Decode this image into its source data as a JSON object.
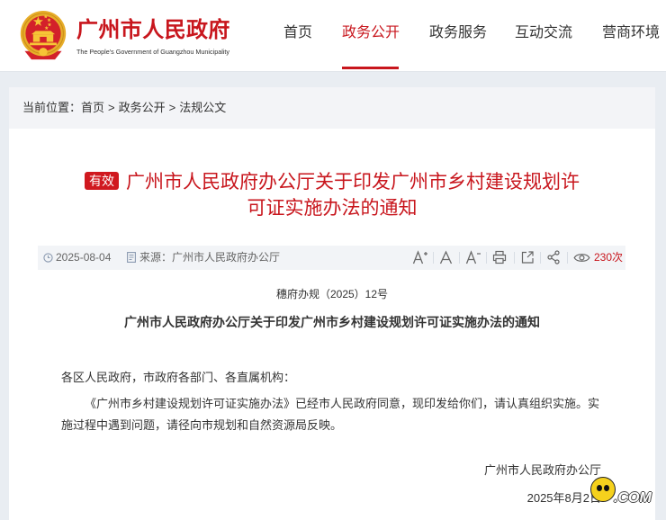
{
  "header": {
    "site_title": "广州市人民政府",
    "site_subtitle": "The People's Government of Guangzhou Municipality",
    "logo_icon": "national-emblem-icon",
    "nav": [
      {
        "label": "首页",
        "active": false
      },
      {
        "label": "政务公开",
        "active": true
      },
      {
        "label": "政务服务",
        "active": false
      },
      {
        "label": "互动交流",
        "active": false
      },
      {
        "label": "营商环境",
        "active": false
      }
    ]
  },
  "breadcrumb": {
    "prefix": "当前位置：",
    "separator": ">",
    "items": [
      "首页",
      "政务公开",
      "法规公文"
    ]
  },
  "article": {
    "status_badge": "有效",
    "title": "广州市人民政府办公厅关于印发广州市乡村建设规划许可证实施办法的通知",
    "meta": {
      "date_icon": "clock-icon",
      "date": "2025-08-04",
      "source_icon": "document-icon",
      "source_label": "来源：",
      "source": "广州市人民政府办公厅",
      "views": "230次"
    },
    "tools": [
      "font-increase-icon",
      "font-reset-icon",
      "font-decrease-icon",
      "print-icon",
      "export-icon",
      "share-icon",
      "views-eye-icon"
    ],
    "doc_number": "穗府办规（2025）12号",
    "heading": "广州市人民政府办公厅关于印发广州市乡村建设规划许可证实施办法的通知",
    "salutation": "各区人民政府，市政府各部门、各直属机构：",
    "body": "《广州市乡村建设规划许可证实施办法》已经市人民政府同意，现印发给你们，请认真组织实施。实施过程中遇到问题，请径向市规划和自然资源局反映。",
    "signature": "广州市人民政府办公厅",
    "signed_date": "2025年8月2日"
  },
  "watermark": {
    "text": ".COM",
    "icon": "smiley-face-icon"
  },
  "colors": {
    "accent": "#c8161d",
    "badge": "#d0191f",
    "page_background": "#e9edf2",
    "meta_bar": "#f2f4f7"
  }
}
